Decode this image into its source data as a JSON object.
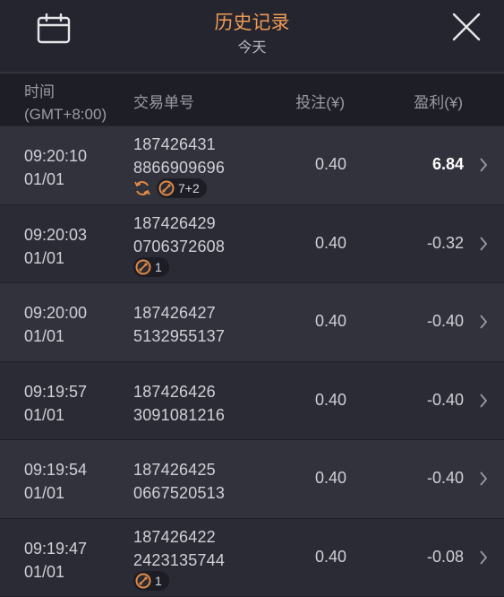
{
  "header": {
    "title": "历史记录",
    "subtitle": "今天"
  },
  "columns": {
    "time_line1": "时间",
    "time_line2": "(GMT+8:00)",
    "order": "交易单号",
    "bet": "投注(¥)",
    "profit": "盈利(¥)"
  },
  "records": [
    {
      "time": "09:20:10",
      "date": "01/01",
      "order_line1": "187426431",
      "order_line2": "8866909696",
      "bet": "0.40",
      "profit": "6.84",
      "win": true,
      "refresh_icon": true,
      "badge": "7+2"
    },
    {
      "time": "09:20:03",
      "date": "01/01",
      "order_line1": "187426429",
      "order_line2": "0706372608",
      "bet": "0.40",
      "profit": "-0.32",
      "win": false,
      "refresh_icon": false,
      "badge": "1"
    },
    {
      "time": "09:20:00",
      "date": "01/01",
      "order_line1": "187426427",
      "order_line2": "5132955137",
      "bet": "0.40",
      "profit": "-0.40",
      "win": false,
      "refresh_icon": false,
      "badge": ""
    },
    {
      "time": "09:19:57",
      "date": "01/01",
      "order_line1": "187426426",
      "order_line2": "3091081216",
      "bet": "0.40",
      "profit": "-0.40",
      "win": false,
      "refresh_icon": false,
      "badge": ""
    },
    {
      "time": "09:19:54",
      "date": "01/01",
      "order_line1": "187426425",
      "order_line2": "0667520513",
      "bet": "0.40",
      "profit": "-0.40",
      "win": false,
      "refresh_icon": false,
      "badge": ""
    },
    {
      "time": "09:19:47",
      "date": "01/01",
      "order_line1": "187426422",
      "order_line2": "2423135744",
      "bet": "0.40",
      "profit": "-0.08",
      "win": false,
      "refresh_icon": false,
      "badge": "1"
    }
  ],
  "icons": {
    "calendar": "calendar-icon",
    "close": "close-icon",
    "row_chevron": "chevron-right-icon",
    "refresh": "refresh-icon",
    "bonus": "bonus-orb-icon"
  },
  "colors": {
    "accent": "#ee9a55",
    "background": "#25252f",
    "row_odd": "#32323d",
    "row_even": "#2b2b35"
  }
}
